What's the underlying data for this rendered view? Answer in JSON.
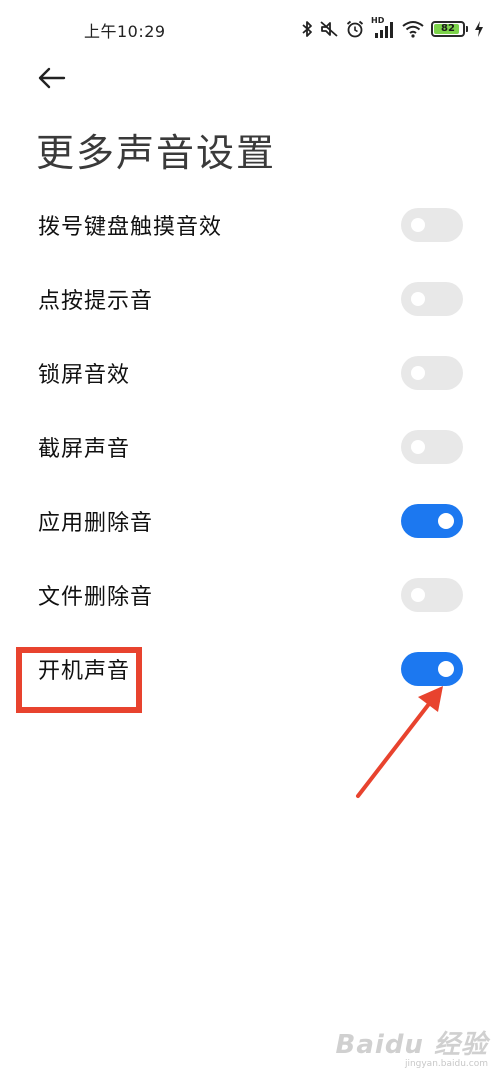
{
  "status_bar": {
    "time": "上午10:29",
    "icons": [
      "bluetooth-icon",
      "mute-icon",
      "alarm-icon",
      "hd-signal-icon",
      "wifi-icon",
      "battery-icon",
      "charging-icon"
    ],
    "hd_label": "HD",
    "battery_level": "82",
    "battery_color": "#7cd34a"
  },
  "header": {
    "back_icon": "arrow-left-icon",
    "title": "更多声音设置"
  },
  "settings": [
    {
      "label": "拨号键盘触摸音效",
      "enabled": false
    },
    {
      "label": "点按提示音",
      "enabled": false
    },
    {
      "label": "锁屏音效",
      "enabled": false
    },
    {
      "label": "截屏声音",
      "enabled": false
    },
    {
      "label": "应用删除音",
      "enabled": true
    },
    {
      "label": "文件删除音",
      "enabled": false
    },
    {
      "label": "开机声音",
      "enabled": true
    }
  ],
  "colors": {
    "toggle_on": "#1c78f0",
    "toggle_off": "#e8e8e8",
    "annotation": "#e8432e"
  },
  "watermark": {
    "brand": "Baidu 经验",
    "url": "jingyan.baidu.com"
  }
}
